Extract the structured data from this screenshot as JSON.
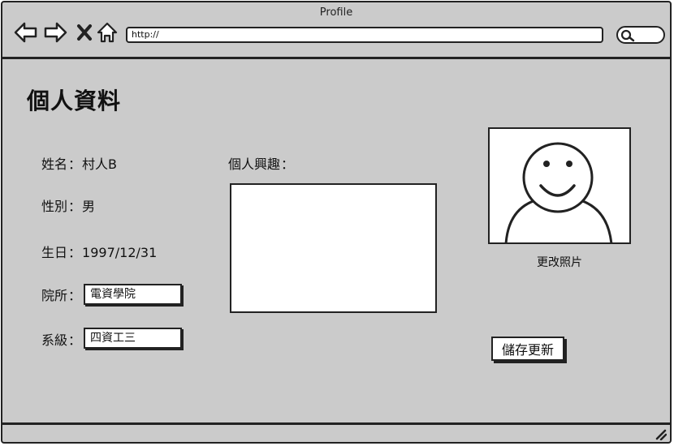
{
  "window": {
    "title": "Profile"
  },
  "toolbar": {
    "back_icon": "arrow-left-icon",
    "forward_icon": "arrow-right-icon",
    "stop_icon": "close-icon",
    "home_icon": "home-icon",
    "url": "http://",
    "search_icon": "search-icon"
  },
  "page": {
    "title": "個人資料",
    "fields": {
      "name": {
        "label": "姓名",
        "sep": "：",
        "value": "村人B"
      },
      "gender": {
        "label": "性別",
        "sep": "：",
        "value": "男"
      },
      "birthday": {
        "label": "生日",
        "sep": "：",
        "value": "1997/12/31"
      },
      "college": {
        "label": "院所",
        "sep": "：",
        "value": "電資學院"
      },
      "department": {
        "label": "系級",
        "sep": "：",
        "value": "四資工三"
      }
    },
    "interests": {
      "label": "個人興趣",
      "sep": "：",
      "value": ""
    },
    "photo": {
      "icon": "user-avatar-icon",
      "change_label": "更改照片"
    },
    "save_label": "儲存更新"
  }
}
